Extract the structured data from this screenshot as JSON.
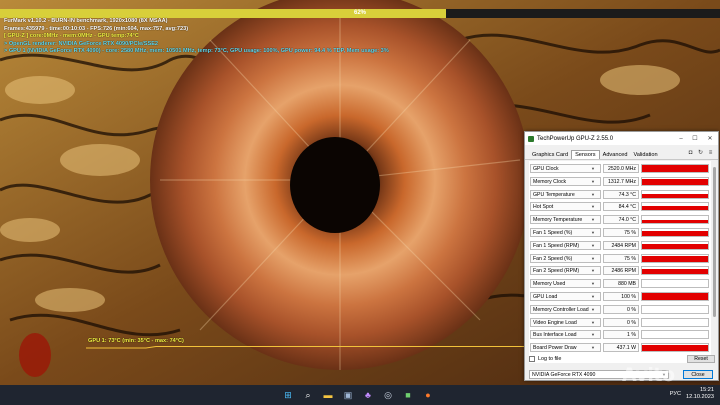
{
  "furmark": {
    "progress": {
      "percent": 62,
      "label": "62%"
    },
    "osd_lines": [
      {
        "text": "FurMark v1.10.2 - BURN-IN benchmark, 1920x1080 (8X MSAA)",
        "color": "white"
      },
      {
        "text": "Frames:435979 - time:00:10:03 - FPS:726 (min:604, max:757, avg:723)",
        "color": "white"
      },
      {
        "text": "[ GPU-Z ] core:0MHz - mem:0MHz - GPU temp:74°C",
        "color": "yellow"
      },
      {
        "text": "> OpenGL renderer: NVIDIA GeForce RTX 4090/PCIe/SSE2",
        "color": "cyan"
      },
      {
        "text": "> GPU 1 (NVIDIA GeForce RTX 4090) - core: 2580 MHz, mem: 10501 MHz, temp: 73°C, GPU usage: 100%, GPU power: 94.4 % TDP, Mem usage: 3%",
        "color": "cyan"
      }
    ],
    "temp_graph_label": "GPU 1: 73°C (min: 35°C - max: 74°C)"
  },
  "gpuz": {
    "title": "TechPowerUp GPU-Z 2.55.0",
    "window_controls": {
      "minimize": "–",
      "maximize": "☐",
      "close": "✕"
    },
    "tabs": [
      {
        "label": "Graphics Card",
        "active": false
      },
      {
        "label": "Sensors",
        "active": true
      },
      {
        "label": "Advanced",
        "active": false
      },
      {
        "label": "Validation",
        "active": false
      }
    ],
    "tab_icons": [
      "camera-icon",
      "refresh-icon",
      "menu-icon"
    ],
    "sensors": [
      {
        "name": "GPU Clock",
        "value": "2520.0 MHz",
        "fill": 0.95
      },
      {
        "name": "Memory Clock",
        "value": "1312.7 MHz",
        "fill": 0.9
      },
      {
        "name": "GPU Temperature",
        "value": "74.3 °C",
        "fill": 0.55
      },
      {
        "name": "Hot Spot",
        "value": "84.4 °C",
        "fill": 0.65
      },
      {
        "name": "Memory Temperature",
        "value": "74.0 °C",
        "fill": 0.5
      },
      {
        "name": "Fan 1 Speed (%)",
        "value": "75 %",
        "fill": 0.75
      },
      {
        "name": "Fan 1 Speed (RPM)",
        "value": "2484 RPM",
        "fill": 0.75
      },
      {
        "name": "Fan 2 Speed (%)",
        "value": "75 %",
        "fill": 0.75
      },
      {
        "name": "Fan 2 Speed (RPM)",
        "value": "2486 RPM",
        "fill": 0.75
      },
      {
        "name": "Memory Used",
        "value": "880 MB",
        "fill": 0.05
      },
      {
        "name": "GPU Load",
        "value": "100 %",
        "fill": 0.95
      },
      {
        "name": "Memory Controller Load",
        "value": "0 %",
        "fill": 0
      },
      {
        "name": "Video Engine Load",
        "value": "0 %",
        "fill": 0
      },
      {
        "name": "Bus Interface Load",
        "value": "1 %",
        "fill": 0.02
      },
      {
        "name": "Board Power Draw",
        "value": "437.1 W",
        "fill": 0.9
      }
    ],
    "log_to_file": "Log to file",
    "reset": "Reset",
    "gpu_select": "NVIDIA GeForce RTX 4090",
    "close": "Close"
  },
  "taskbar": {
    "icons": [
      "windows-start-icon",
      "search-icon",
      "file-explorer-icon",
      "task-view-icon",
      "gamepad-icon",
      "steam-icon",
      "gpuz-taskbar-icon",
      "furmark-taskbar-icon"
    ],
    "lang": "РУС",
    "time": "15:21",
    "date": "12.10.2023"
  },
  "watermark": "Avito"
}
